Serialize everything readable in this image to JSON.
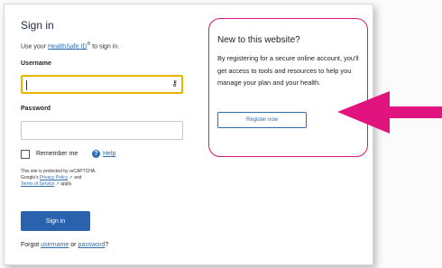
{
  "signin": {
    "title": "Sign in",
    "subtitle_prefix": "Use your ",
    "subtitle_link": "HealthSafe ID",
    "subtitle_sup": "®",
    "subtitle_suffix": " to sign in.",
    "username_label": "Username",
    "username_value": "",
    "password_label": "Password",
    "password_value": "",
    "remember_label": "Remember me",
    "help_icon_glyph": "?",
    "help_label": "Help",
    "captcha_line1": "This site is protected by reCAPTCHA.",
    "captcha_line2_prefix": "Google's ",
    "captcha_privacy_link": "Privacy Policy",
    "captcha_line2_suffix": " and",
    "captcha_terms_link": "Terms of Service",
    "captcha_line3_suffix": " apply.",
    "external_icon_glyph": "↗",
    "key_icon_glyph": "⚷",
    "signin_button": "Sign in",
    "forgot_prefix": "Forgot ",
    "forgot_username": "username",
    "forgot_or": " or ",
    "forgot_password": "password",
    "forgot_suffix": "?"
  },
  "register": {
    "title": "New to this website?",
    "body": "By registering for a secure online account, you'll get access to tools and resources to help you manage your plan and your health.",
    "button": "Register now"
  },
  "icons": {
    "key": "key-icon",
    "help": "help-circle-icon",
    "external": "external-link-icon",
    "arrow": "pointer-arrow-icon"
  },
  "colors": {
    "accent_blue": "#2a62ad",
    "link_blue": "#2f6db3",
    "highlight_magenta": "#e0137f",
    "focus_gold": "#e8b500"
  }
}
